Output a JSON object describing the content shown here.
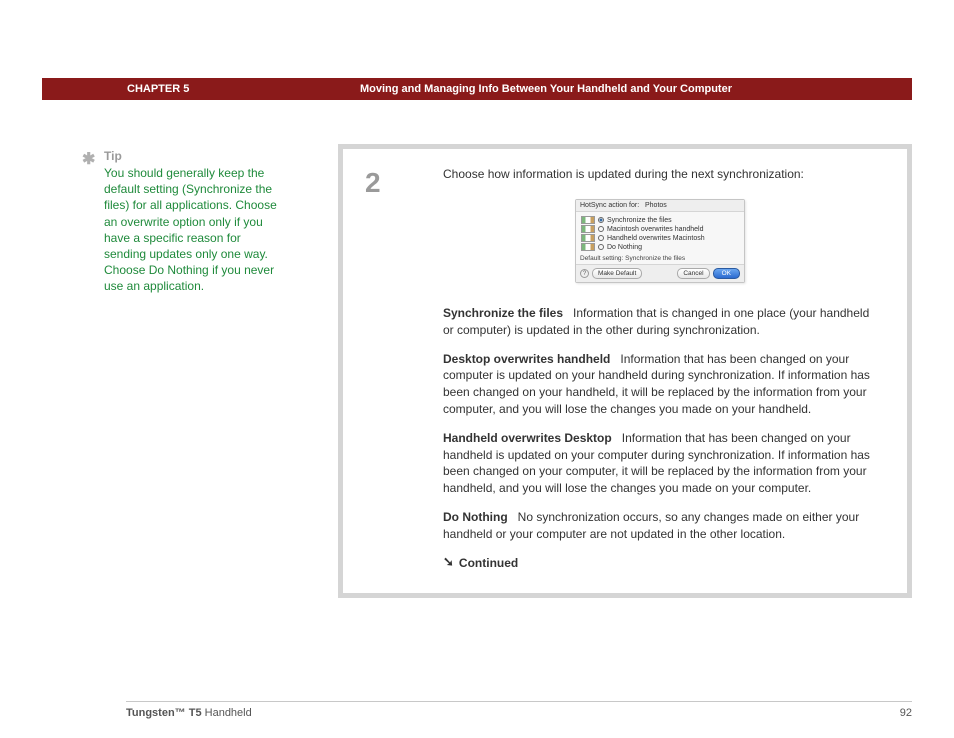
{
  "header": {
    "chapter": "CHAPTER 5",
    "title": "Moving and Managing Info Between Your Handheld and Your Computer"
  },
  "sidebar": {
    "tip_label": "Tip",
    "tip_body": "You should generally keep the default setting (Synchronize the files) for all applications. Choose an overwrite option only if you have a specific reason for sending updates only one way. Choose Do Nothing if you never use an application."
  },
  "step": {
    "number": "2",
    "lead": "Choose how information is updated during the next synchronization:"
  },
  "dialog": {
    "header_prefix": "HotSync action for:",
    "header_app": "Photos",
    "options": [
      "Synchronize the files",
      "Macintosh overwrites handheld",
      "Handheld overwrites Macintosh",
      "Do Nothing"
    ],
    "default_label": "Default setting:  Synchronize the files",
    "make_default": "Make Default",
    "cancel": "Cancel",
    "ok": "OK"
  },
  "definitions": {
    "sync_title": "Synchronize the files",
    "sync_body": "Information that is changed in one place (your handheld or computer) is updated in the other during synchronization.",
    "desktop_title": "Desktop overwrites handheld",
    "desktop_body": "Information that has been changed on your computer is updated on your handheld during synchronization. If information has been changed on your handheld, it will be replaced by the information from your computer, and you will lose the changes you made on your handheld.",
    "handheld_title": "Handheld overwrites Desktop",
    "handheld_body": "Information that has been changed on your handheld is updated on your computer during synchronization. If information has been changed on your computer, it will be replaced by the information from your handheld, and you will lose the changes you made on your computer.",
    "nothing_title": "Do Nothing",
    "nothing_body": "No synchronization occurs, so any changes made on either your handheld or your computer are not updated in the other location."
  },
  "continued": "Continued",
  "footer": {
    "product_bold": "Tungsten™ T5",
    "product_rest": " Handheld",
    "page": "92"
  }
}
